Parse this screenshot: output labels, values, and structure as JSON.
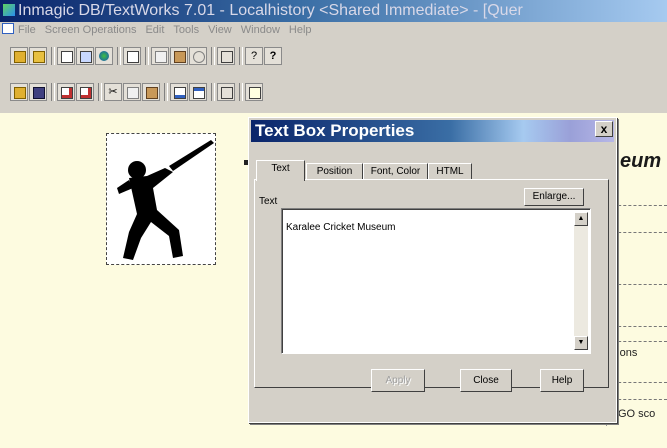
{
  "window": {
    "title": "Inmagic DB/TextWorks 7.01 - Localhistory <Shared Immediate> - [Quer"
  },
  "menubar": {
    "items": [
      "File",
      "Screen Operations",
      "Edit",
      "Tools",
      "View",
      "Window",
      "Help"
    ]
  },
  "toolbar1": {
    "icons": [
      "open-folder-icon",
      "open-form-icon",
      "screen-icon",
      "query-icon",
      "globe-icon",
      "document-icon",
      "copy-icon",
      "clipboard-icon",
      "undo-icon",
      "query-by-example-icon",
      "help-icon",
      "context-help-icon"
    ]
  },
  "toolbar2": {
    "icons": [
      "open-folder-icon",
      "save-icon",
      "new-box-icon",
      "new-field-icon",
      "cut-icon",
      "copy-icon",
      "paste-icon",
      "properties-icon",
      "window-icon",
      "layout-icon",
      "image-icon"
    ]
  },
  "canvas": {
    "heading_fragment": "eum",
    "options_fragment": "ptions",
    "go_fragment": "GO sco"
  },
  "dialog": {
    "title": "Text Box Properties",
    "close_glyph": "x",
    "tabs": [
      "Text",
      "Position",
      "Font, Color",
      "HTML"
    ],
    "active_tab": "Text",
    "text_label": "Text",
    "enlarge_label": "Enlarge...",
    "text_value": "Karalee Cricket Museum",
    "apply_label": "Apply",
    "close_label": "Close",
    "help_label": "Help"
  },
  "colors": {
    "canvas_background": "#fdfbe0",
    "title_bar": "#0a246a",
    "dialog_face": "#d4d0c8"
  }
}
